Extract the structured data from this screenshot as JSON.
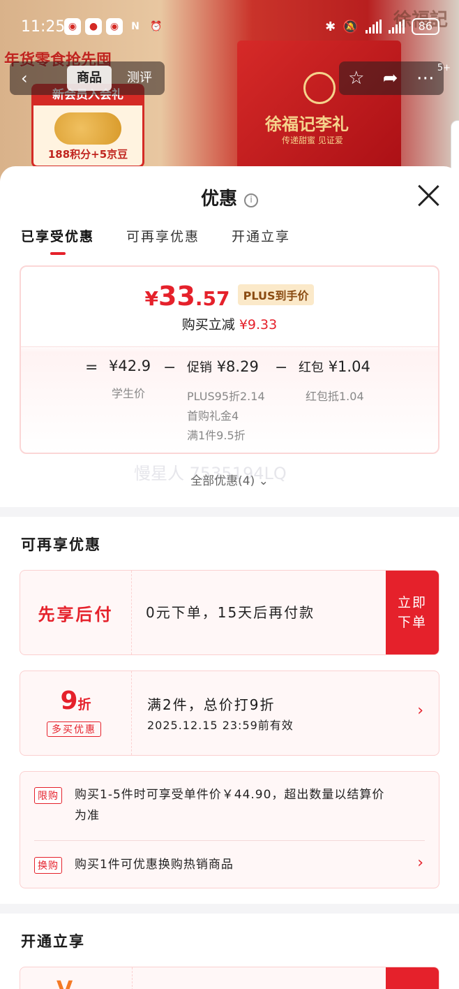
{
  "status_bar": {
    "time": "11:25",
    "battery": "86"
  },
  "background": {
    "banner_text": "年货零食抢先囤",
    "promo_title": "新会员入会礼",
    "promo_body": "188积分+5京豆",
    "promo_num": "188",
    "brand_logo": "徐福記",
    "gift_brand": "徐福记李礼",
    "gift_slogan": "传递甜蜜 见证爱"
  },
  "nav": {
    "tab_goods": "商品",
    "tab_review": "测评",
    "badge": "5+"
  },
  "sheet": {
    "title": "优惠",
    "tabs": [
      "已享受优惠",
      "可再享优惠",
      "开通立享"
    ]
  },
  "price_card": {
    "yen": "¥",
    "price_int": "33",
    "price_dec": ".57",
    "plus_tag": "PLUS到手价",
    "reduce_label": "购买立减",
    "reduce_amount": "¥9.33",
    "eq": "=",
    "minus": "−",
    "student_price": "¥42.9",
    "student_label": "学生价",
    "promo_label": "促销",
    "promo_amount": "¥8.29",
    "promo_items": [
      "PLUS95折2.14",
      "首购礼金4",
      "满1件9.5折"
    ],
    "redpack_label": "红包",
    "redpack_amount": "¥1.04",
    "redpack_note": "红包抵1.04"
  },
  "all_discounts": "全部优惠(4)",
  "watermark": "慢星人 7535194LQ",
  "more_section": {
    "title": "可再享优惠",
    "pay_later": {
      "label": "先享后付",
      "desc": "0元下单，15天后再付款",
      "cta_line1": "立即",
      "cta_line2": "下单"
    },
    "discount": {
      "num": "9",
      "unit": "折",
      "tag": "多买优惠",
      "title": "满2件，总价打9折",
      "valid": "2025.12.15 23:59前有效"
    },
    "rules": {
      "limit_tag": "限购",
      "limit_text_1": "购买1-5件时可享受单件价￥44.90，超出数量以结算价",
      "limit_text_2": "为准",
      "swap_tag": "换购",
      "swap_text": "购买1件可优惠换购热销商品"
    }
  },
  "open_section": {
    "title": "开通立享"
  }
}
